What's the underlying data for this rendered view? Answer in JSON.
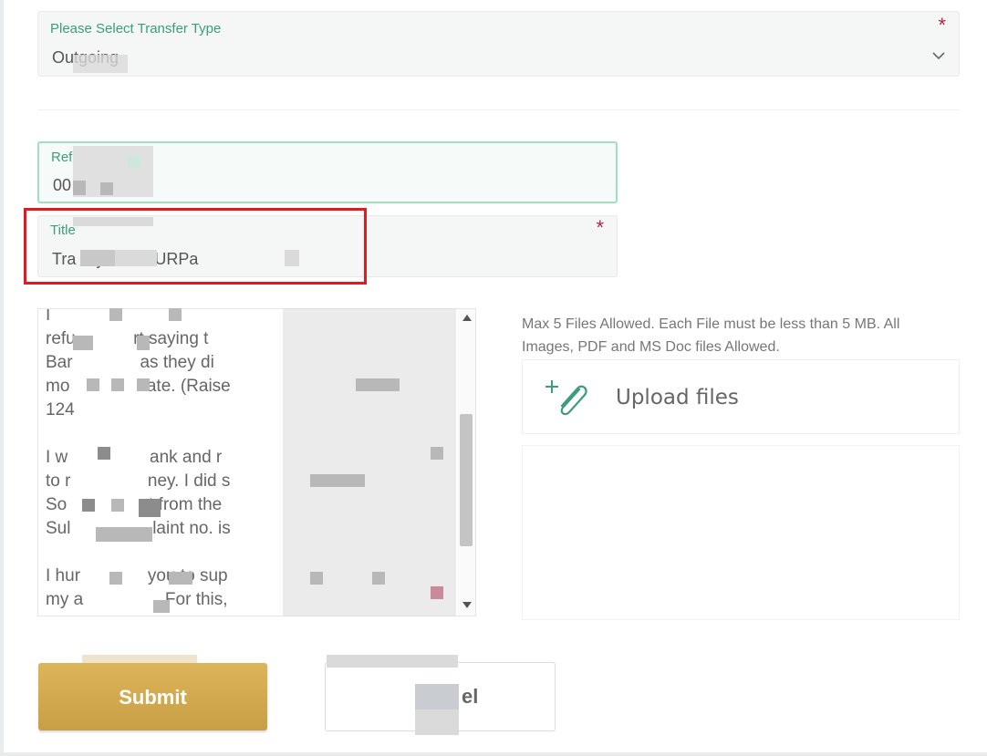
{
  "form": {
    "transfer_type": {
      "label": "Please Select Transfer Type",
      "value": "Outgoing",
      "required_mark": "*"
    },
    "reference": {
      "label": "Ref",
      "value": "00"
    },
    "title": {
      "label": "Title",
      "value": "Tra         Riyadh to URPa",
      "required_mark": "*"
    },
    "description": {
      "text": "I\nrefu            rt saying t\nBar              as they di\nmo                ate. (Raise\n124\n\nI w                 ank and r\nto r                ney. I did s\nSo                 t from the\nSul                 laint no. is\n\nI hur              you to sup\nmy a               . For this,"
    },
    "upload": {
      "hint": "Max 5 Files Allowed. Each File must be less than 5 MB. All Images, PDF and MS Doc files Allowed.",
      "button_label": "Upload files"
    },
    "submit_label": "Submit",
    "cancel_label": "el"
  },
  "colors": {
    "accent_green": "#3a9d7d",
    "submit_gold": "#d3aa50",
    "required_red": "#b0254a",
    "highlight_red": "#e01b22"
  }
}
